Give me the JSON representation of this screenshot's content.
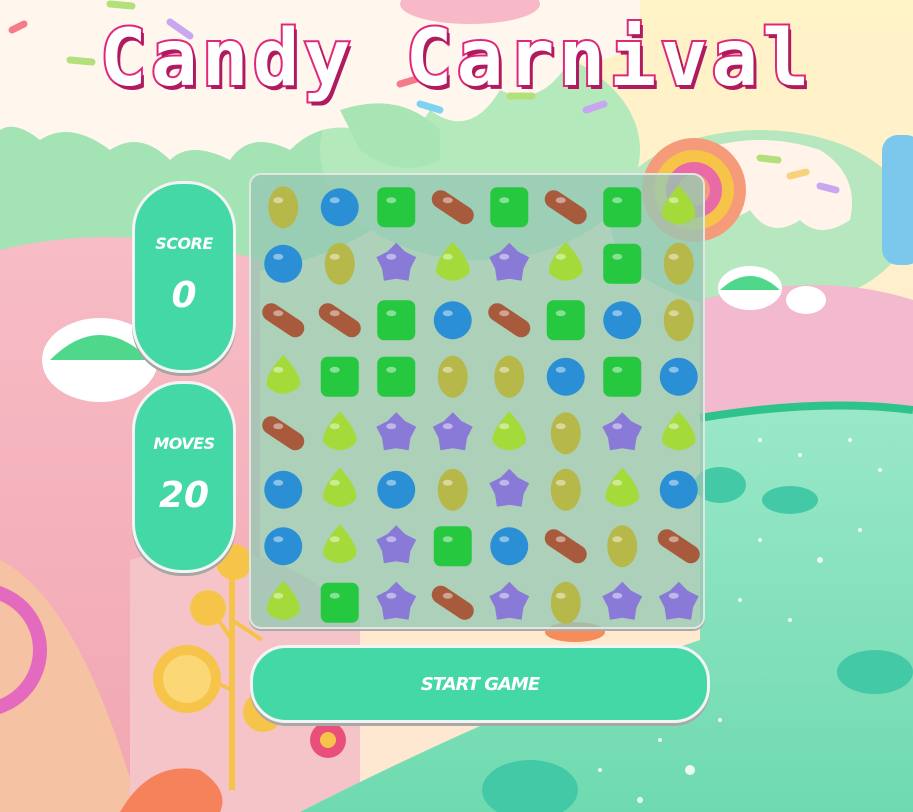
{
  "title": "Candy Carnival",
  "score": {
    "label": "SCORE",
    "value": "0"
  },
  "moves": {
    "label": "MOVES",
    "value": "20"
  },
  "start_button_label": "START GAME",
  "colors": {
    "panel": "#44d8a6",
    "title_outline": "#e0287a",
    "candy_brown": "#a85a3c",
    "candy_blue": "#2b8fd6",
    "candy_green": "#25c83f",
    "candy_olive": "#b6b84a",
    "candy_lime": "#a4da3a",
    "candy_purple": "#8a7ad8"
  },
  "board": {
    "rows": 8,
    "cols": 8,
    "grid": [
      [
        "olive",
        "blue",
        "green",
        "brown",
        "green",
        "brown",
        "green",
        "lime"
      ],
      [
        "blue",
        "olive",
        "purple",
        "lime",
        "purple",
        "lime",
        "green",
        "olive"
      ],
      [
        "brown",
        "brown",
        "green",
        "blue",
        "brown",
        "green",
        "blue",
        "olive"
      ],
      [
        "lime",
        "green",
        "green",
        "olive",
        "olive",
        "blue",
        "green",
        "blue"
      ],
      [
        "brown",
        "lime",
        "purple",
        "purple",
        "lime",
        "olive",
        "purple",
        "lime"
      ],
      [
        "blue",
        "lime",
        "blue",
        "olive",
        "purple",
        "olive",
        "lime",
        "blue"
      ],
      [
        "blue",
        "lime",
        "purple",
        "green",
        "blue",
        "brown",
        "olive",
        "brown"
      ],
      [
        "lime",
        "green",
        "purple",
        "brown",
        "purple",
        "olive",
        "purple",
        "purple"
      ]
    ]
  }
}
